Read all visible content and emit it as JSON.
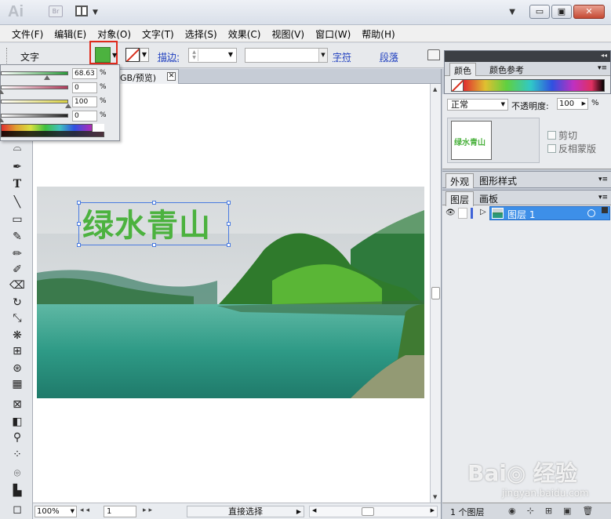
{
  "app": {
    "logo": "Ai",
    "bridge": "Br"
  },
  "window_controls": {
    "menu_arrow": "▼",
    "minimize": "▭",
    "maximize": "▣",
    "close": "✕"
  },
  "menubar": [
    "文件(F)",
    "编辑(E)",
    "对象(O)",
    "文字(T)",
    "选择(S)",
    "效果(C)",
    "视图(V)",
    "窗口(W)",
    "帮助(H)"
  ],
  "controlbar": {
    "label": "文字",
    "fill_color": "#4cb23f",
    "stroke_label": "描边:",
    "character_link": "字符",
    "paragraph_link": "段落"
  },
  "document_tab": {
    "title": "GB/预览)",
    "close": "✕"
  },
  "artboard": {
    "headline": "绿水青山",
    "headline_color": "#4cb23f"
  },
  "color_popup": {
    "rows": [
      {
        "value": "68.63",
        "unit": "%",
        "fill_fraction": 0.6863,
        "color": "#2a9a3a"
      },
      {
        "value": "0",
        "unit": "%",
        "fill_fraction": 0,
        "color": "#b03a5a"
      },
      {
        "value": "100",
        "unit": "%",
        "fill_fraction": 1.0,
        "color": "#d8d040"
      },
      {
        "value": "0",
        "unit": "%",
        "fill_fraction": 0,
        "color": "#222222"
      }
    ]
  },
  "color_panel": {
    "tabs": [
      "颜色",
      "颜色参考"
    ],
    "arrows": "◂◂"
  },
  "transparency_panel": {
    "blend_mode": "正常",
    "opacity_label": "不透明度:",
    "opacity_value": "100",
    "opacity_unit": "%",
    "thumbnail_text": "绿水青山",
    "clip_label": "剪切",
    "invert_mask_label": "反相蒙版"
  },
  "appearance_panel": {
    "tabs": [
      "外观",
      "图形样式"
    ]
  },
  "layers_panel": {
    "tabs": [
      "图层",
      "画板"
    ],
    "layers": [
      {
        "name": "图层 1",
        "color": "#3f63d8"
      }
    ],
    "count_text": "1 个图层"
  },
  "statusbar": {
    "zoom": "100%",
    "page": "1",
    "tool": "直接选择"
  },
  "watermark": {
    "main": "Bai◎ 经验",
    "sub": "jingyan.baidu.com"
  }
}
